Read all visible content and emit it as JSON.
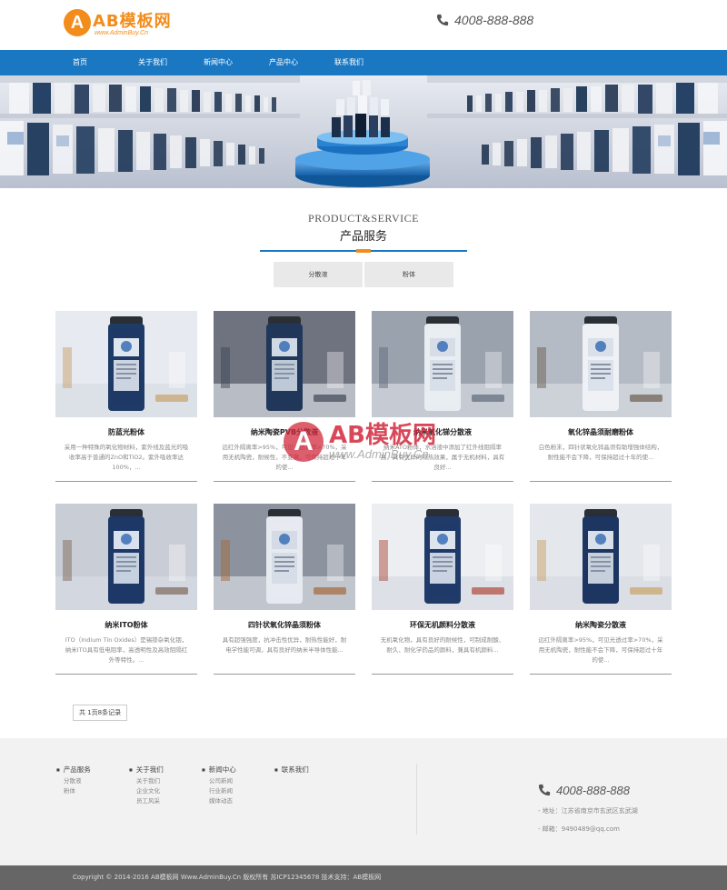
{
  "header": {
    "logo_mark": "A",
    "logo_text": "AB模板网",
    "logo_sub": "www.AdminBuy.Cn",
    "phone": "4008-888-888"
  },
  "nav": [
    "首页",
    "关于我们",
    "新闻中心",
    "产品中心",
    "联系我们"
  ],
  "section": {
    "title_en": "PRODUCT&SERVICE",
    "title_cn": "产品服务",
    "filters": [
      "分散液",
      "粉体"
    ]
  },
  "products": [
    {
      "title": "防蓝光粉体",
      "desc": "采用一种特殊的氧化物材料，紫外线及蓝光的吸收率高于普通的ZnO和TiO2。紫外吸收率达100%，..."
    },
    {
      "title": "纳米陶瓷PVB分散液",
      "desc": "远红外隔离率>95%，可见光透过率>70%，采用无机陶瓷，耐候性，不变黄，可保持超过十年的使..."
    },
    {
      "title": "纳米氧化锑分散液",
      "desc": "纳米ATO粉体，水溶液中添加了红外线阻隔率高，具有优异的隔热效果，属于无机材料，具有良好..."
    },
    {
      "title": "氧化锌晶须耐磨粉体",
      "desc": "白色粉末，四针状氧化锌晶须有助增强体结构，耐性能不会下降，可保持超过十年的使..."
    },
    {
      "title": "纳米ITO粉体",
      "desc": "ITO（Indium Tin Oxides）是锡掺杂氧化铟，纳米ITO具有低电阻率，高透明性及高效阻隔红外等特性。..."
    },
    {
      "title": "四针状氧化锌晶须粉体",
      "desc": "具有超强强度，抗冲击性优异，耐热性能好，耐电学性能可调，具有良好的纳米半导体性能..."
    },
    {
      "title": "环保无机颜料分散液",
      "desc": "无机氧化物，具有良好的耐候性，可制成耐酸、耐久、耐化学药品的颜料，兼具有机颜料..."
    },
    {
      "title": "纳米陶瓷分散液",
      "desc": "远红外隔离率>95%，可见光透过率>70%，采用无机陶瓷，耐性能不会下降，可保持超过十年的使..."
    }
  ],
  "pager": "共 1页8条记录",
  "footer": {
    "columns": [
      {
        "heading": "产品服务",
        "items": [
          "分散液",
          "粉体"
        ]
      },
      {
        "heading": "关于我们",
        "items": [
          "关于我们",
          "企业文化",
          "员工风采"
        ]
      },
      {
        "heading": "新闻中心",
        "items": [
          "公司新闻",
          "行业新闻",
          "媒体动态"
        ]
      },
      {
        "heading": "联系我们",
        "items": []
      }
    ],
    "phone": "4008-888-888",
    "address": "- 地址：江苏省南京市玄武区玄武湖",
    "email": "- 邮箱：9490489@qq.com"
  },
  "copyright": "Copyright © 2014-2016 AB模板网 Www.AdminBuy.Cn 版权所有 苏ICP12345678 技术支持：AB模板网",
  "watermark": {
    "mark": "A",
    "text": "AB模板网",
    "sub": "www.AdminBuy.Cn"
  },
  "colors": {
    "primary": "#1a78c2",
    "accent": "#f28c1b",
    "footer_bg": "#f2f2f2",
    "copyright_bg": "#666666"
  }
}
